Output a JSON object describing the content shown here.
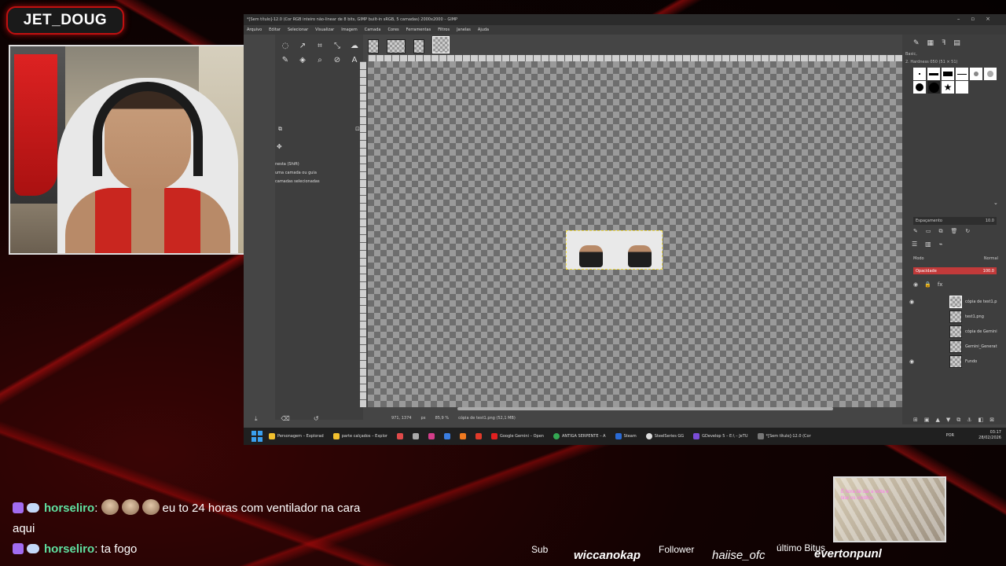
{
  "overlay": {
    "streamer_name": "JET_DOUG"
  },
  "gimp": {
    "window_title": "*[Sem título]-12.0 (Cor RGB inteiro não-linear de 8 bits, GIMP built-in sRGB, 5 camadas) 2000x2000 – GIMP",
    "menu": [
      "Arquivo",
      "Editar",
      "Selecionar",
      "Visualizar",
      "Imagem",
      "Camada",
      "Cores",
      "Ferramentas",
      "Filtros",
      "Janelas",
      "Ajuda"
    ],
    "tool_options": {
      "line1": "nesta (Shift)",
      "line2": "uma camada ou guia",
      "line3": "camadas selecionadas"
    },
    "status": {
      "coords": "971, 1374",
      "unit": "px",
      "zoom": "85,9 %",
      "layer_info": "cópia de test1.png (52,1 MB)"
    },
    "brushes": {
      "preset": "Basic,",
      "current": "2. Hardness 050 (51 × 51)"
    },
    "spacing": {
      "label": "Espaçamento",
      "value": "10.0"
    },
    "mode": {
      "label": "Modo",
      "value": "Normal"
    },
    "opacity": {
      "label": "Opacidade",
      "value": "100.0"
    },
    "layers": [
      {
        "name": "cópia de test1.p",
        "visible": true,
        "selected": true
      },
      {
        "name": "test1.png",
        "visible": false,
        "selected": false
      },
      {
        "name": "cópia de Gemini",
        "visible": false,
        "selected": false
      },
      {
        "name": "Gemini_Generat",
        "visible": false,
        "selected": false
      },
      {
        "name": "Fundo",
        "visible": true,
        "selected": false
      }
    ]
  },
  "taskbar": {
    "items": [
      {
        "label": "Personagem – Explorad",
        "color": "#f2c02e"
      },
      {
        "label": "parte calçados – Explor",
        "color": "#f2c02e"
      },
      {
        "label": "",
        "color": "#e04a4a"
      },
      {
        "label": "",
        "color": "#aaaaaa"
      },
      {
        "label": "",
        "color": "#d43d8a"
      },
      {
        "label": "",
        "color": "#3a7de0"
      },
      {
        "label": "",
        "color": "#f07a20"
      },
      {
        "label": "",
        "color": "#e03a2a"
      },
      {
        "label": "Google Gemini – Open",
        "color": "#e02020"
      },
      {
        "label": "ANTIGA SERPENTE – A",
        "color": "#34a853"
      },
      {
        "label": "Steam",
        "color": "#2a6ad4"
      },
      {
        "label": "SteelSeries GG",
        "color": "#dddddd"
      },
      {
        "label": "GDevelop 5 – E:\\ – JeTU",
        "color": "#7a4cd6"
      },
      {
        "label": "*[Sem título]-12.0 (Cor",
        "color": "#777777"
      }
    ],
    "language": "POR",
    "time": "03:17",
    "date": "28/02/2026"
  },
  "chat": [
    {
      "user": "horseliro",
      "message": "eu to 24 horas com ventilador na cara aqui",
      "emotes": 3
    },
    {
      "user": "horseliro",
      "message": "ta fogo",
      "emotes": 0
    }
  ],
  "alert_box": {
    "text": "É hora de dar a volta e tirar os créditos"
  },
  "stats": {
    "sub_label": "Sub",
    "sub_value": "wiccanokap",
    "follower_label": "Follower",
    "follower_value": "haiise_ofc",
    "bits_label": "último Bitus",
    "bits_value": "evertonpunl"
  }
}
